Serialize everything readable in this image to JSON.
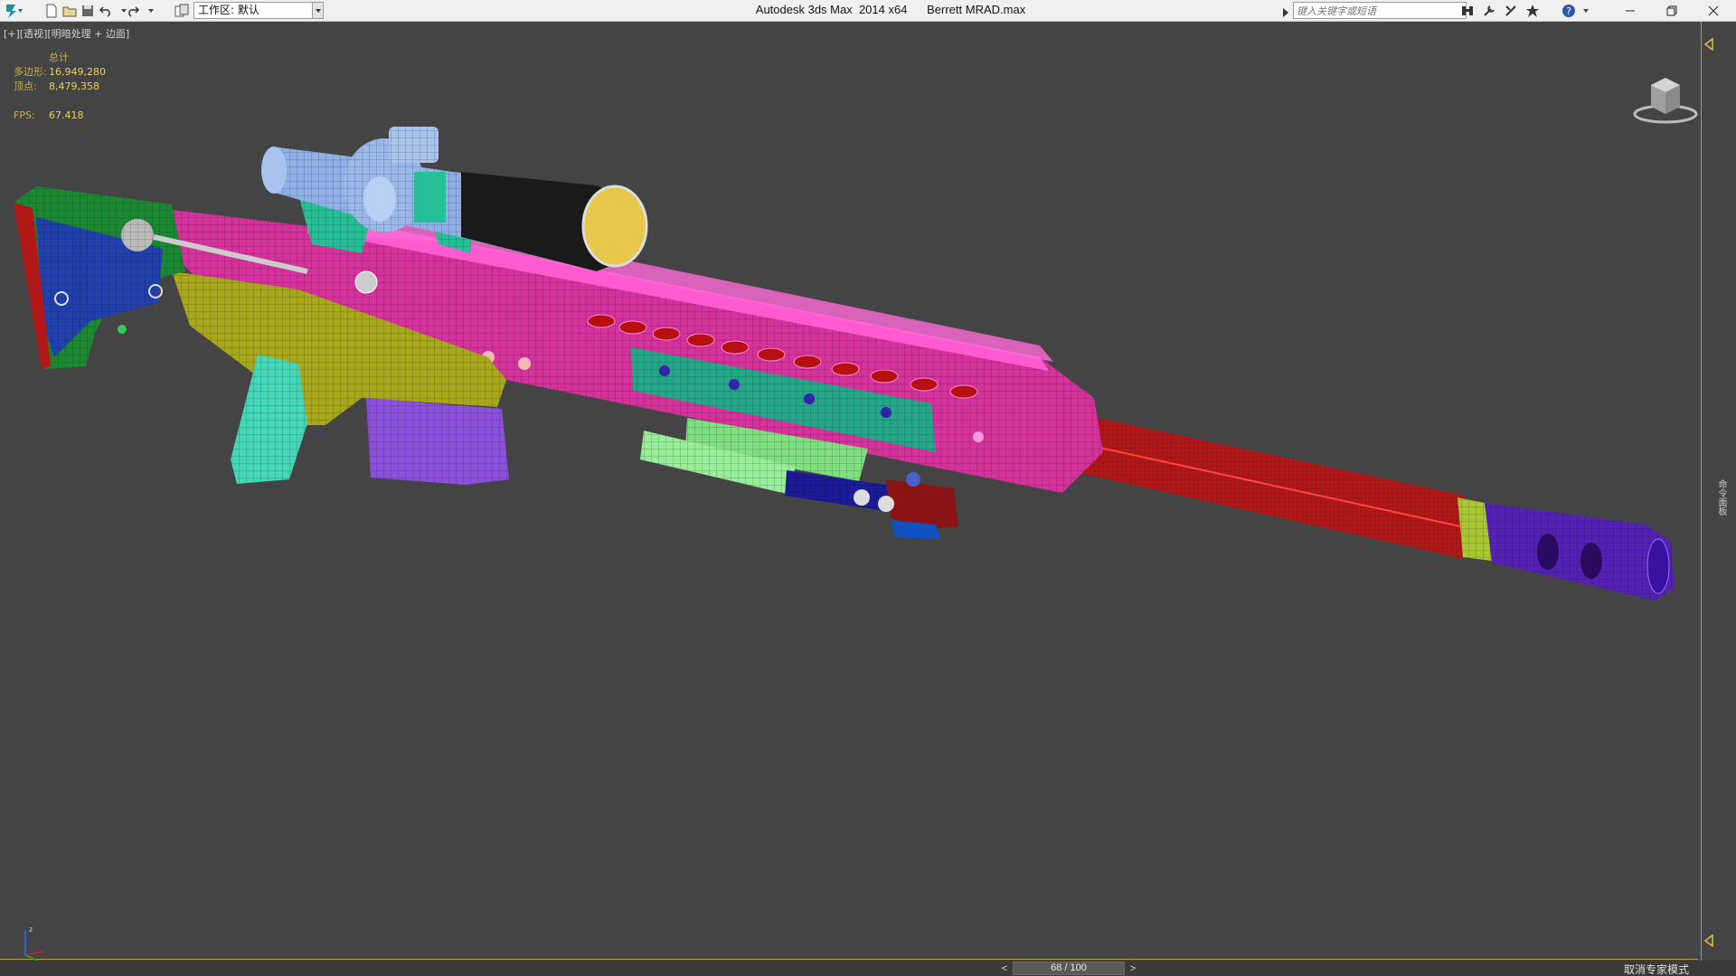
{
  "titlebar": {
    "app_title": "Autodesk 3ds Max  2014 x64",
    "file_name": "Berrett MRAD.max",
    "workspace_label": "工作区: 默认",
    "search_placeholder": "键入关键字或短语"
  },
  "viewport": {
    "label": "[+][透视][明暗处理 + 边面]",
    "stats": {
      "header": "总计",
      "polys_label": "多边形:",
      "polys_value": "16,949,280",
      "verts_label": "顶点:",
      "verts_value": "8,479,358",
      "fps_label": "FPS:",
      "fps_value": "67.418"
    },
    "side_panel_text": "命令面板"
  },
  "timeline": {
    "frame_display": "68 / 100",
    "prev": "<",
    "next": ">",
    "expert_mode_label": "取消专家模式"
  },
  "colors": {
    "viewport_bg": "#444444",
    "frame_accent": "#b69b3c",
    "stats_text": "#e8d25a",
    "stock": "#22aa44",
    "receiver": "#ff44cc",
    "grip": "#44e0c0",
    "lower": "#c8c820",
    "magazine": "#9955ee",
    "barrel": "#cc1111",
    "muzzle": "#6622cc",
    "scope": "#8fb0e8",
    "bipod": "#88ee88"
  },
  "icons": [
    "app-logo-icon",
    "new-file-icon",
    "open-file-icon",
    "save-icon",
    "undo-icon",
    "redo-icon",
    "project-folder-icon",
    "infocenter-icon",
    "tools-icon",
    "connection-icon",
    "favorites-icon",
    "help-icon",
    "minimize-icon",
    "restore-icon",
    "close-icon"
  ]
}
